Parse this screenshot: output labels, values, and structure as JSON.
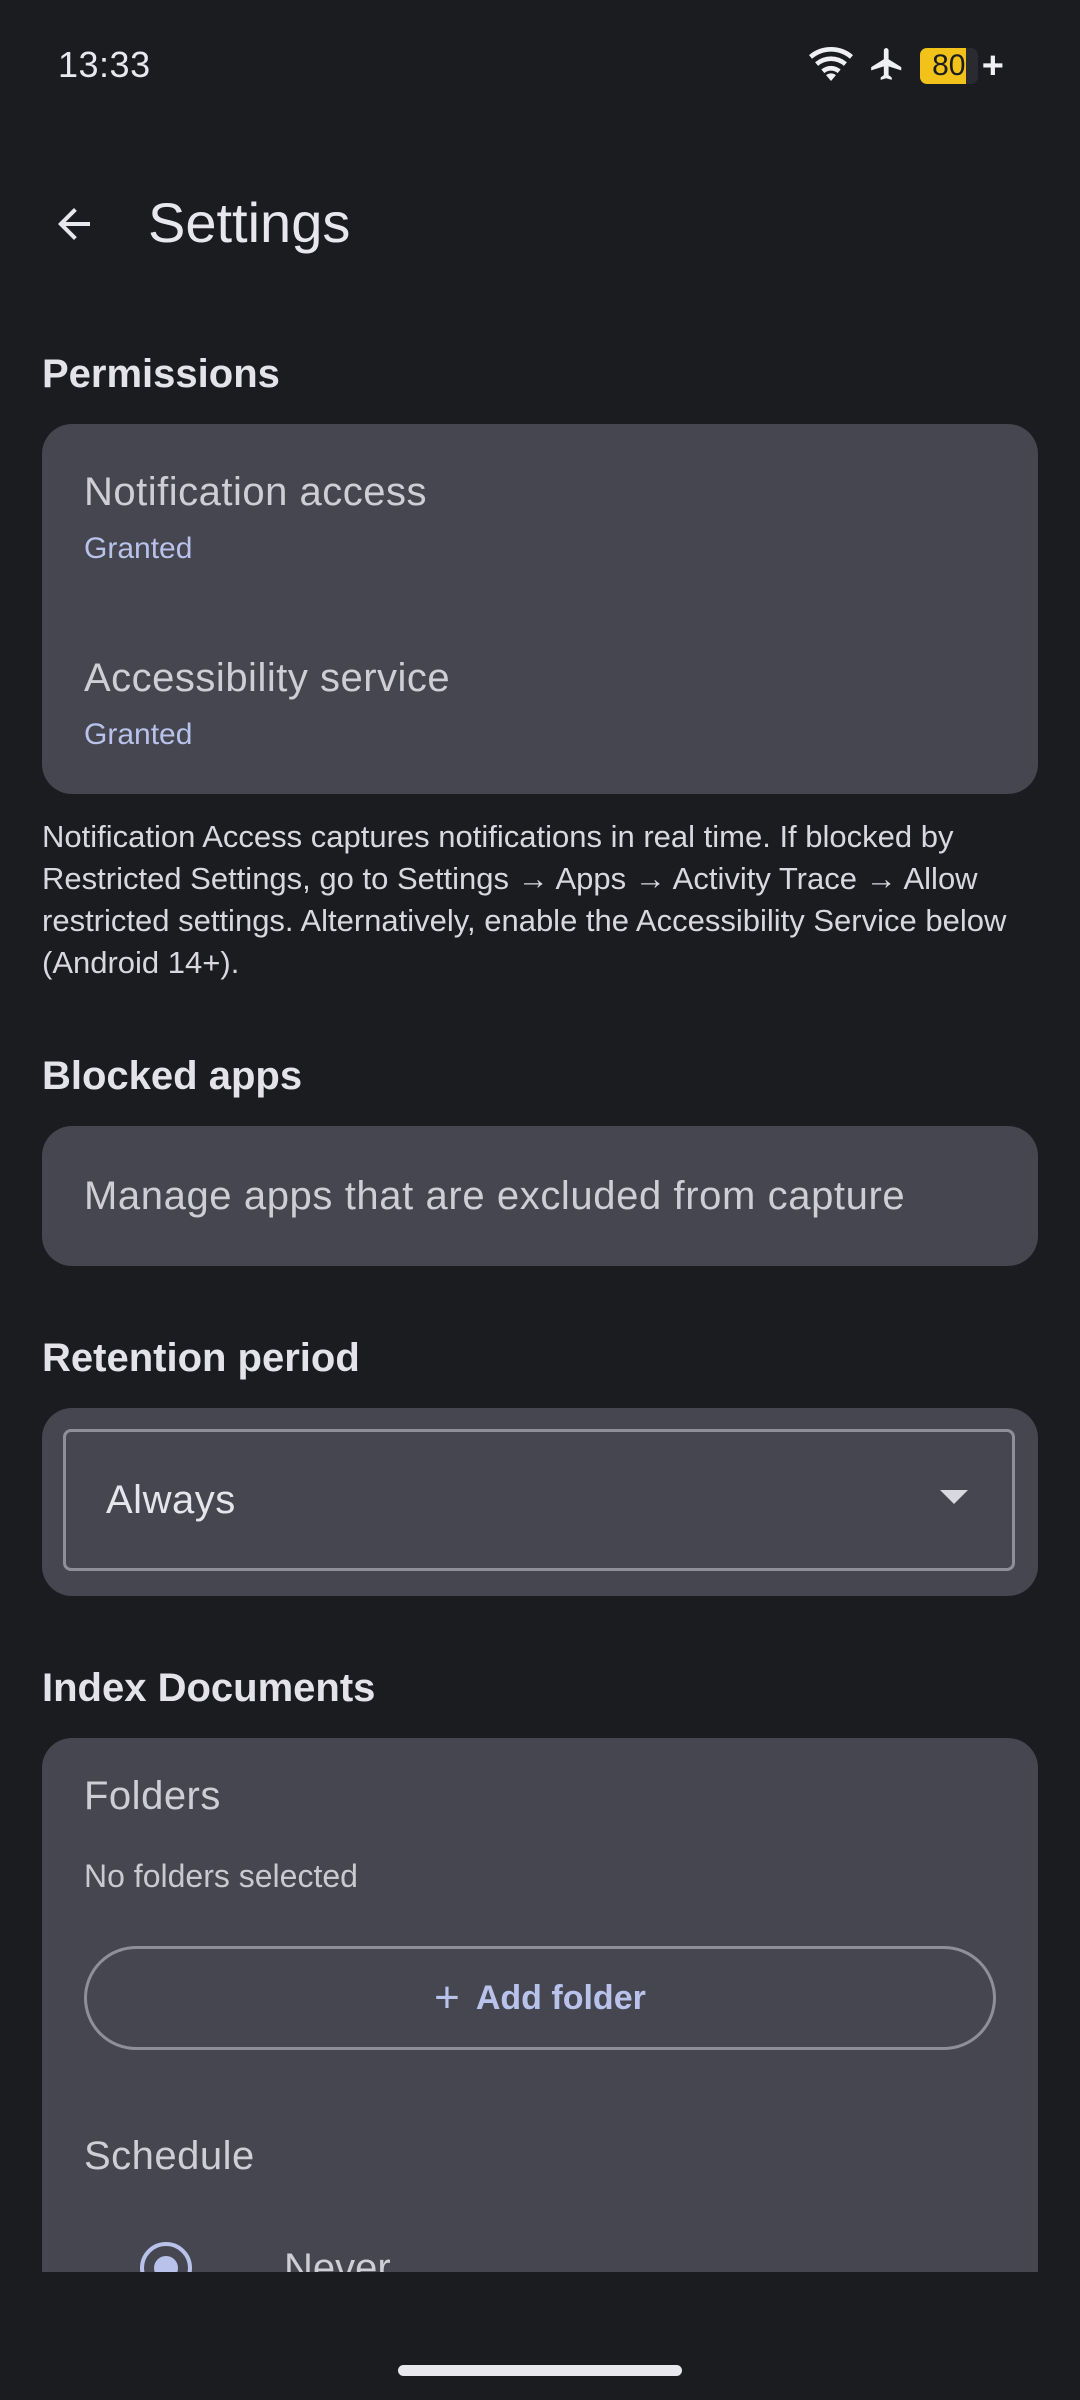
{
  "status_bar": {
    "time": "13:33",
    "battery_level": "80",
    "battery_fraction": 0.8,
    "icons": [
      "wifi-icon",
      "airplane-mode-icon",
      "battery-icon",
      "charging-icon"
    ]
  },
  "app_bar": {
    "back_icon": "arrow-back-icon",
    "title": "Settings"
  },
  "permissions": {
    "heading": "Permissions",
    "items": [
      {
        "title": "Notification access",
        "status": "Granted"
      },
      {
        "title": "Accessibility service",
        "status": "Granted"
      }
    ],
    "help_text": "Notification Access captures notifications in real time. If blocked by Restricted Settings, go to Settings → Apps → Activity Trace → Allow restricted settings. Alternatively, enable the Accessibility Service below (Android 14+)."
  },
  "blocked_apps": {
    "heading": "Blocked apps",
    "label": "Manage apps that are excluded from capture"
  },
  "retention": {
    "heading": "Retention period",
    "selected": "Always"
  },
  "index_documents": {
    "heading": "Index Documents",
    "folders_title": "Folders",
    "folders_empty": "No folders selected",
    "add_folder_label": "Add folder",
    "schedule_title": "Schedule",
    "schedule_options": [
      {
        "label": "Never",
        "selected": true
      }
    ]
  },
  "colors": {
    "background": "#1b1c20",
    "card": "#45464f",
    "accent": "#b9c2ea",
    "battery": "#f2c21b"
  }
}
